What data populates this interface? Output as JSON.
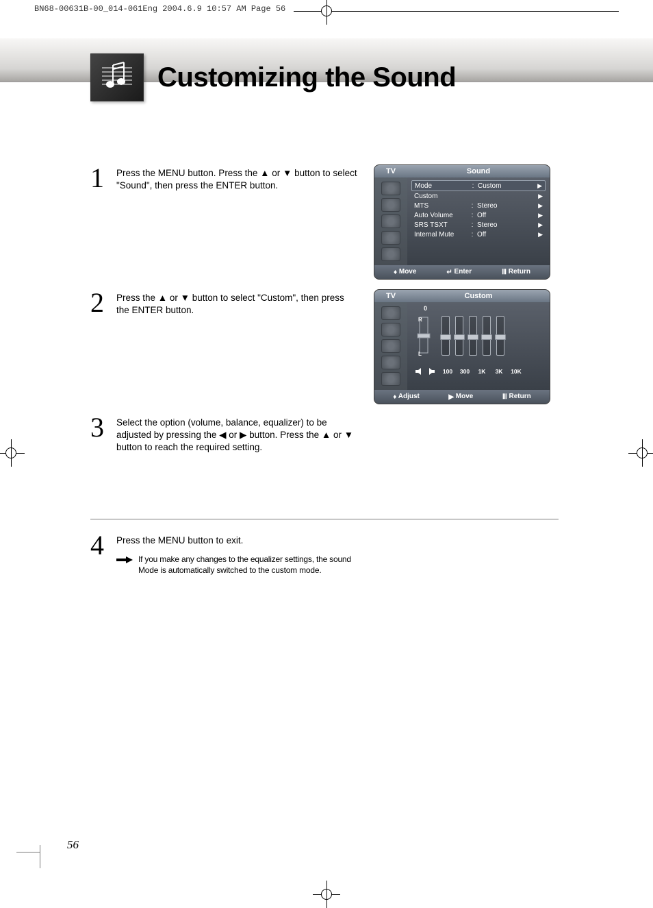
{
  "print_header": "BN68-00631B-00_014-061Eng  2004.6.9  10:57 AM  Page 56",
  "title": "Customizing the Sound",
  "page_number": "56",
  "steps": [
    {
      "num": "1",
      "text": "Press the MENU button. Press the ▲ or ▼ button to select \"Sound\", then press the ENTER button."
    },
    {
      "num": "2",
      "text": "Press the ▲ or ▼ button to select \"Custom\", then press the ENTER button."
    },
    {
      "num": "3",
      "text": "Select the option (volume, balance, equalizer) to be adjusted by pressing the ◀ or ▶ button. Press the ▲ or ▼ button to reach the required setting."
    },
    {
      "num": "4",
      "text": "Press the MENU button to exit.",
      "note": "If you make any changes to the equalizer settings, the sound Mode is automatically switched to the custom mode."
    }
  ],
  "osd1": {
    "tv": "TV",
    "title": "Sound",
    "rows": [
      {
        "label": "Mode",
        "value": "Custom",
        "hi": true
      },
      {
        "label": "Custom",
        "value": ""
      },
      {
        "label": "MTS",
        "value": "Stereo"
      },
      {
        "label": "Auto Volume",
        "value": "Off"
      },
      {
        "label": "SRS TSXT",
        "value": "Stereo"
      },
      {
        "label": "Internal Mute",
        "value": "Off"
      }
    ],
    "hint_move": "Move",
    "hint_enter": "Enter",
    "hint_return": "Return"
  },
  "osd2": {
    "tv": "TV",
    "title": "Custom",
    "value_label": "0",
    "balance_r": "R",
    "balance_l": "L",
    "eq_bands": [
      "100",
      "300",
      "1K",
      "3K",
      "10K"
    ],
    "hint_adjust": "Adjust",
    "hint_move": "Move",
    "hint_return": "Return"
  }
}
